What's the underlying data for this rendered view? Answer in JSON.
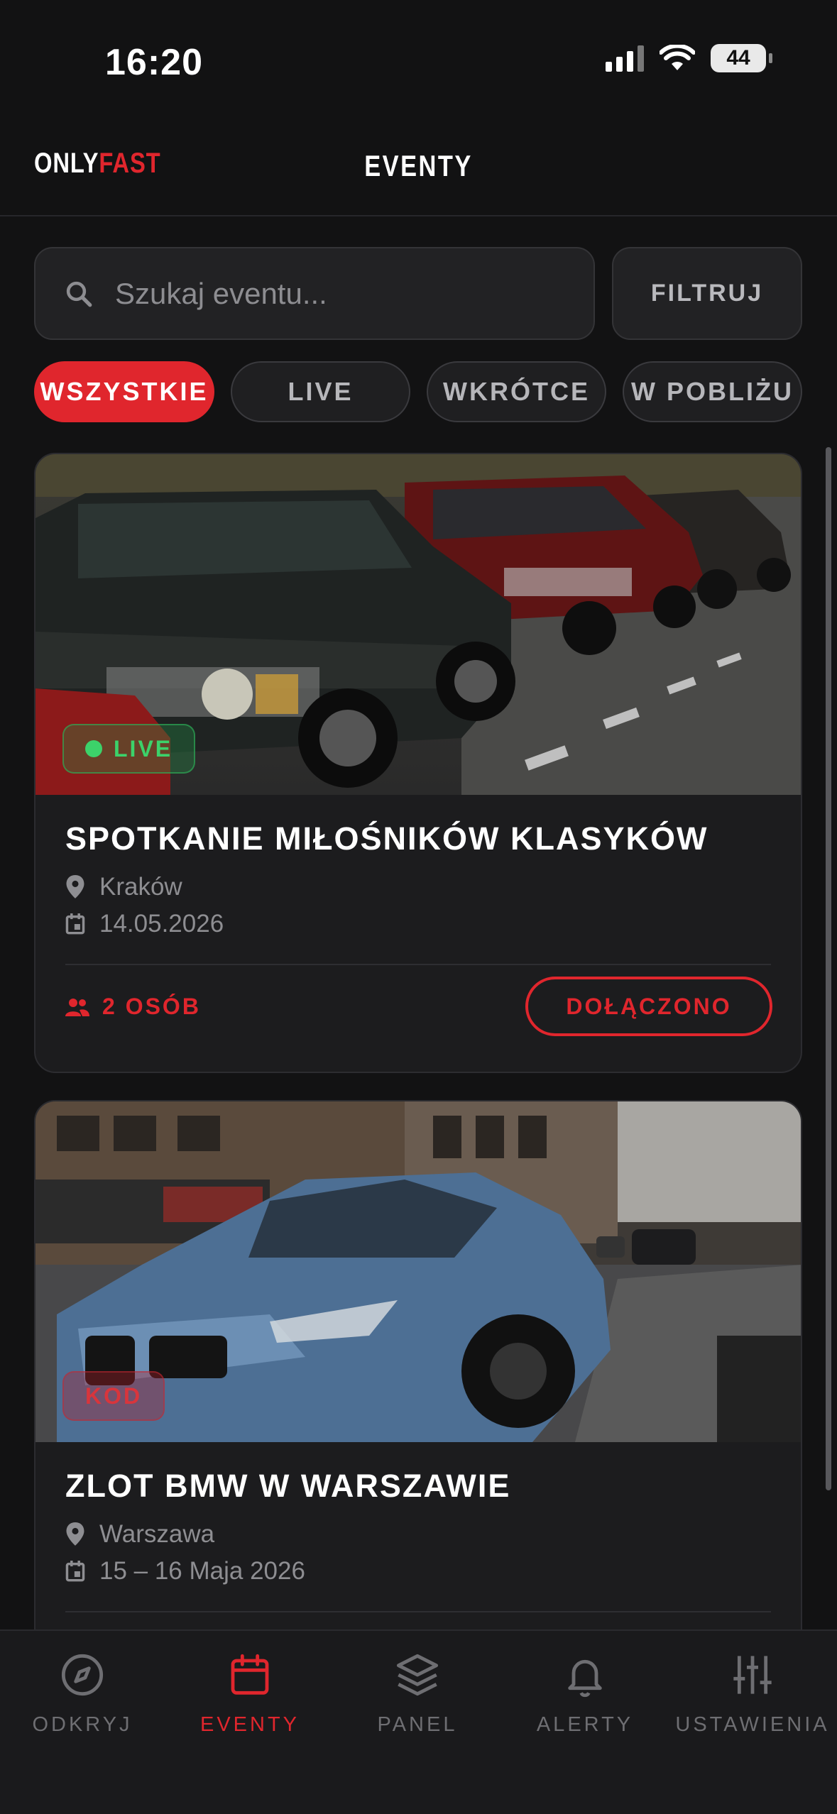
{
  "status_bar": {
    "time": "16:20",
    "battery": "44"
  },
  "header": {
    "logo_part1": "ONLY",
    "logo_part2": "FAST",
    "title": "EVENTY"
  },
  "search": {
    "placeholder": "Szukaj eventu...",
    "filter_label": "FILTRUJ"
  },
  "chips": [
    {
      "label": "WSZYSTKIE",
      "active": true
    },
    {
      "label": "LIVE",
      "active": false
    },
    {
      "label": "WKRÓTCE",
      "active": false
    },
    {
      "label": "W POBLIŻU",
      "active": false
    }
  ],
  "events": [
    {
      "badge": "LIVE",
      "title": "SPOTKANIE MIŁOŚNIKÓW KLASYKÓW",
      "location": "Kraków",
      "date": "14.05.2026",
      "people": "2 OSÓB",
      "action_label": "DOŁĄCZONO"
    },
    {
      "badge": "KOD",
      "title": "ZLOT BMW W WARSZAWIE",
      "location": "Warszawa",
      "date": "15 – 16 Maja 2026"
    }
  ],
  "tabs": [
    {
      "label": "ODKRYJ",
      "icon": "compass-icon"
    },
    {
      "label": "EVENTY",
      "icon": "calendar-icon",
      "active": true
    },
    {
      "label": "PANEL",
      "icon": "layers-icon"
    },
    {
      "label": "ALERTY",
      "icon": "bell-icon"
    },
    {
      "label": "USTAWIENIA",
      "icon": "sliders-icon"
    }
  ],
  "colors": {
    "accent": "#e0262d",
    "live": "#3cd26a",
    "background": "#121213",
    "card": "#1c1c1e"
  }
}
